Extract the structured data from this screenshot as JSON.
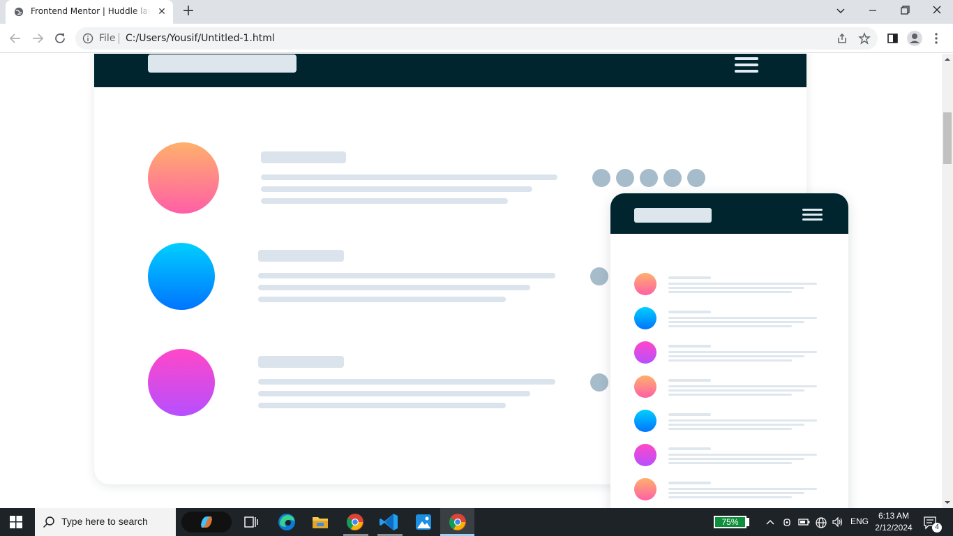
{
  "browser": {
    "tab_title": "Frontend Mentor | Huddle landing page",
    "tab_close": "✕",
    "new_tab": "+",
    "omnibox_scheme": "File",
    "url": "C:/Users/Yousif/Untitled-1.html",
    "window_controls": {
      "minimize": "—",
      "restore": "❐",
      "close": "✕",
      "tab_search": "⌄"
    }
  },
  "page": {
    "desktop_rows": [
      {
        "gradient": "orange-pink"
      },
      {
        "gradient": "cyan-blue"
      },
      {
        "gradient": "pink-violet"
      }
    ],
    "mobile_rows": [
      {
        "gradient": "orange-pink"
      },
      {
        "gradient": "cyan-blue"
      },
      {
        "gradient": "pink-violet"
      },
      {
        "gradient": "orange-pink"
      },
      {
        "gradient": "cyan-blue"
      },
      {
        "gradient": "pink-violet"
      },
      {
        "gradient": "orange-pink"
      }
    ],
    "colors": {
      "nav": "#00252e",
      "skeleton": "#dbe4ec",
      "dot": "#a6bccb"
    }
  },
  "taskbar": {
    "search_placeholder": "Type here to search",
    "battery": "75%",
    "language": "ENG",
    "time": "6:13 AM",
    "date": "2/12/2024",
    "notifications": "4"
  }
}
